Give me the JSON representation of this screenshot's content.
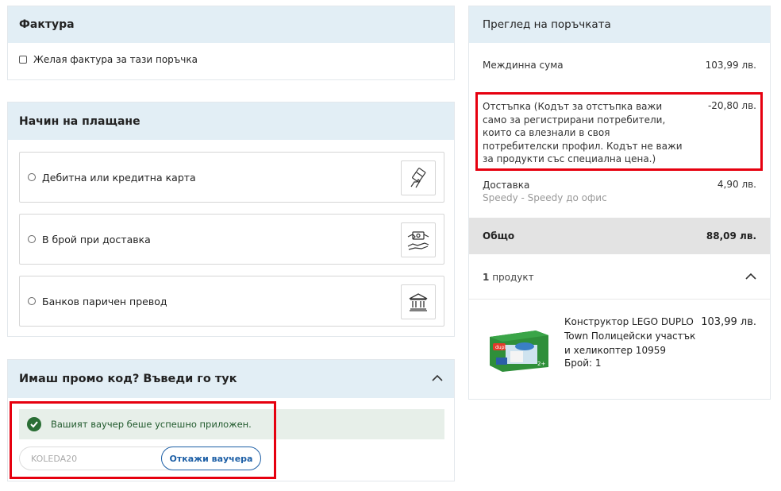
{
  "invoice": {
    "title": "Фактура",
    "checkbox_label": "Желая фактура за тази поръчка"
  },
  "payment": {
    "title": "Начин на плащане",
    "options": [
      {
        "label": "Дебитна или кредитна карта",
        "icon": "card-hand-icon"
      },
      {
        "label": "В брой при доставка",
        "icon": "cash-handover-icon"
      },
      {
        "label": "Банков паричен превод",
        "icon": "bank-icon"
      }
    ]
  },
  "promo": {
    "title": "Имаш промо код? Въведи го тук",
    "success_message": "Вашият ваучер беше успешно приложен.",
    "code_value": "KOLEDA20",
    "cancel_label": "Откажи ваучера"
  },
  "summary": {
    "title": "Преглед на поръчката",
    "subtotal_label": "Междинна сума",
    "subtotal_value": "103,99 лв.",
    "discount_label": "Отстъпка (Кодът за отстъпка важи само за регистрирани потребители, които са влезнали в своя потребителски профил. Кодът не важи за продукти със специална цена.)",
    "discount_value": "-20,80 лв.",
    "delivery_label": "Доставка",
    "delivery_sub": "Speedy - Speedy до офис",
    "delivery_value": "4,90 лв.",
    "total_label": "Общо",
    "total_value": "88,09 лв.",
    "product_count_num": "1",
    "product_count_word": "продукт",
    "product": {
      "name": "Конструктор LEGO DUPLO Town Полицейски участък и хеликоптер 10959",
      "qty": "Брой: 1",
      "price": "103,99 лв."
    }
  },
  "colors": {
    "header_bg": "#e2eef5",
    "highlight": "#e6000f",
    "accent_blue": "#1d5fa6",
    "success_green": "#2a6e35"
  }
}
